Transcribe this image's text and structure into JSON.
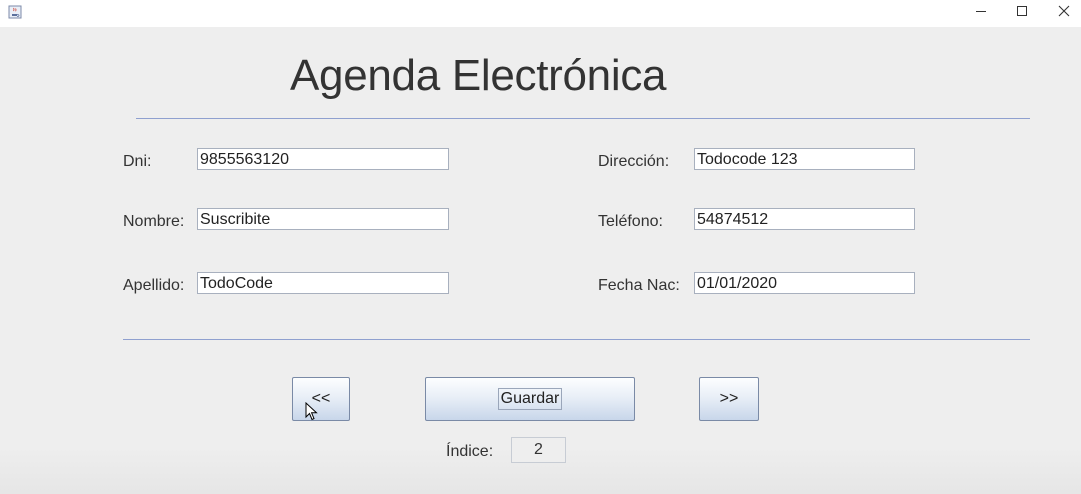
{
  "window": {
    "icon": "java-cup-icon",
    "controls": {
      "minimize": "minimize-icon",
      "maximize": "maximize-icon",
      "close": "close-icon"
    }
  },
  "header": {
    "title": "Agenda Electrónica"
  },
  "form": {
    "dni": {
      "label": "Dni:",
      "value": "9855563120"
    },
    "nombre": {
      "label": "Nombre:",
      "value": "Suscribite"
    },
    "apellido": {
      "label": "Apellido:",
      "value": "TodoCode"
    },
    "direccion": {
      "label": "Dirección:",
      "value": "Todocode 123"
    },
    "telefono": {
      "label": "Teléfono:",
      "value": "54874512"
    },
    "fecha_nac": {
      "label": "Fecha Nac:",
      "value": "01/01/2020"
    }
  },
  "buttons": {
    "prev": "<<",
    "save": "Guardar",
    "next": ">>"
  },
  "index": {
    "label": "Índice:",
    "value": "2"
  },
  "colors": {
    "background": "#eeeeee",
    "separator": "#8fa0cf",
    "button_border": "#7a8aa6"
  }
}
